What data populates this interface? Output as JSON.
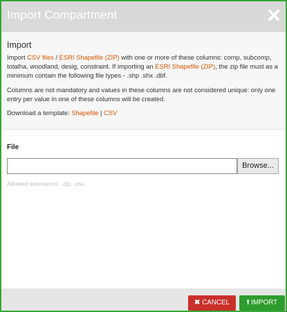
{
  "dialog": {
    "title": "Import Compartment",
    "close_icon": "close-icon"
  },
  "info": {
    "heading": "Import",
    "p1_pre": "Import ",
    "csv_files_link": "CSV files",
    "sep1": " / ",
    "esri_link_1": "ESRI Shapefile (ZIP)",
    "p1_mid": " with one or more of these columns: comp, subcomp, totalha, woodland, desig, constraint. If importing an ",
    "esri_link_2": "ESRI Shapefile (ZIP)",
    "p1_post": ", the zip file must as a minimum contain the following file types - .shp .shx .dbf.",
    "p2": "Columns are not mandatory and values in these columns are not considered unique: only one entry per value in one of these columns will be created.",
    "p3_pre": "Download a template: ",
    "shapefile_link": "Shapefile",
    "sep2": " | ",
    "csv_link": "CSV"
  },
  "file": {
    "label": "File",
    "value": "",
    "browse_label": "Browse...",
    "allowed_extensions": "Allowed extensions: .zip, .csv"
  },
  "footer": {
    "cancel_label": "CANCEL",
    "cancel_icon": "x-icon",
    "import_label": "IMPORT",
    "import_icon": "upload-icon"
  },
  "colors": {
    "accent_border": "#35a835",
    "header_bg": "#d9d9d9",
    "link": "#d35400",
    "cancel": "#c9302c",
    "import": "#2e9c2e"
  }
}
